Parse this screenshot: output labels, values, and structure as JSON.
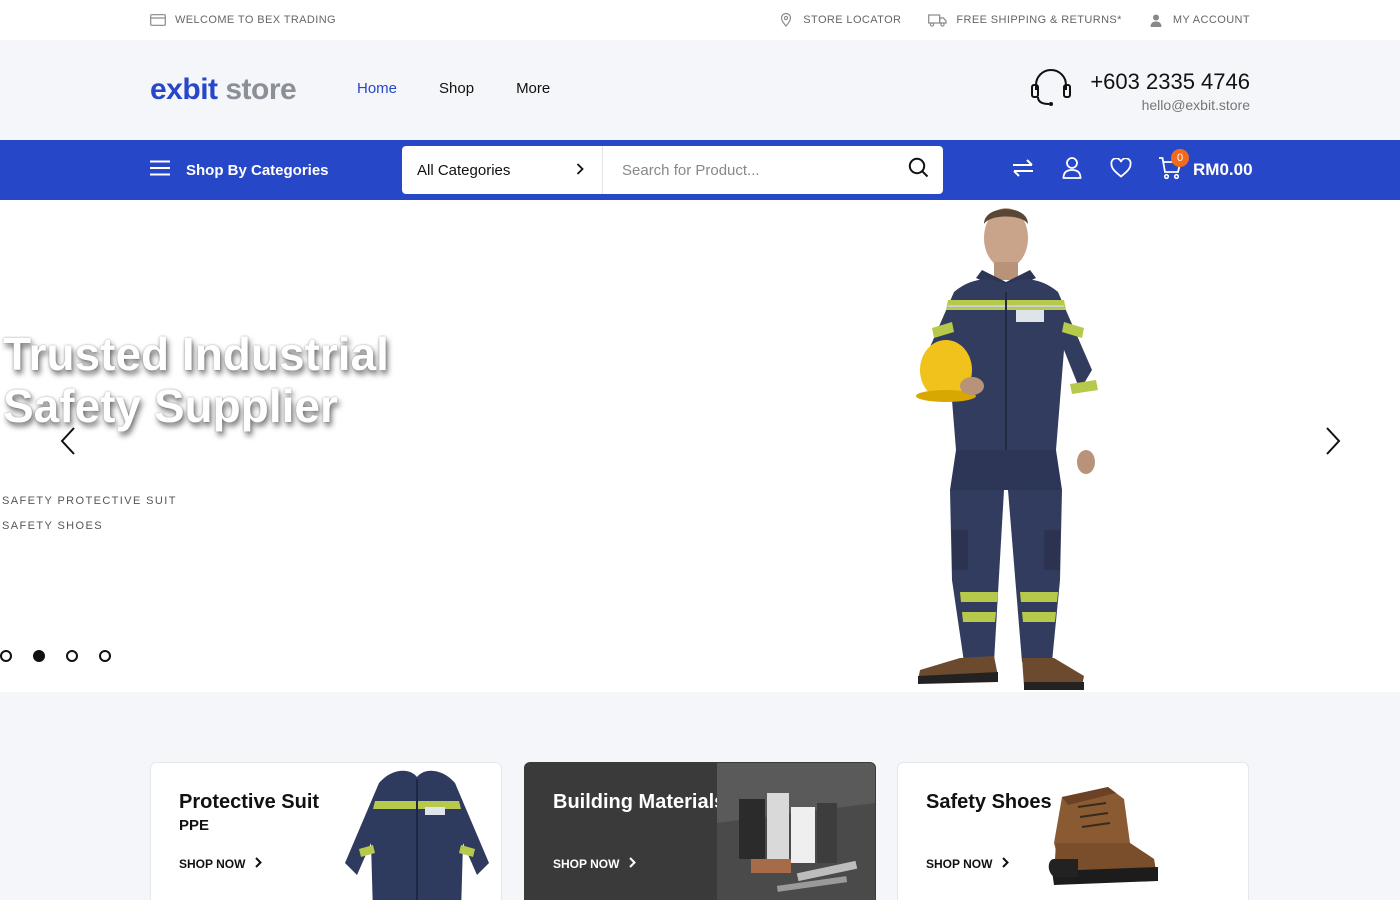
{
  "topbar": {
    "welcome": "WELCOME TO BEX TRADING",
    "store_locator": "STORE LOCATOR",
    "shipping": "FREE SHIPPING & RETURNS*",
    "account": "MY ACCOUNT"
  },
  "header": {
    "logo_part1": "exbit",
    "logo_part2": "store",
    "nav": [
      {
        "label": "Home",
        "active": true
      },
      {
        "label": "Shop",
        "active": false
      },
      {
        "label": "More",
        "active": false
      }
    ],
    "phone": "+603 2335 4746",
    "email": "hello@exbit.store"
  },
  "bluebar": {
    "categories_label": "Shop By Categories",
    "search_category": "All Categories",
    "search_placeholder": "Search for Product...",
    "cart_count": "0",
    "cart_total": "RM0.00"
  },
  "hero": {
    "title_line1": "Trusted Industrial",
    "title_line2": "Safety Supplier",
    "subitems": [
      "SAFETY PROTECTIVE SUIT",
      "SAFETY SHOES"
    ],
    "slides": 4,
    "active_slide": 1
  },
  "cards": [
    {
      "title": "Protective Suit",
      "sub": "PPE",
      "cta": "SHOP NOW"
    },
    {
      "title": "Building Materials",
      "sub": "",
      "cta": "SHOP NOW"
    },
    {
      "title": "Safety Shoes",
      "sub": "",
      "cta": "SHOP NOW"
    }
  ],
  "colors": {
    "brand_blue": "#2747c9",
    "badge_orange": "#f26a1b",
    "header_bg": "#f4f6f9"
  }
}
